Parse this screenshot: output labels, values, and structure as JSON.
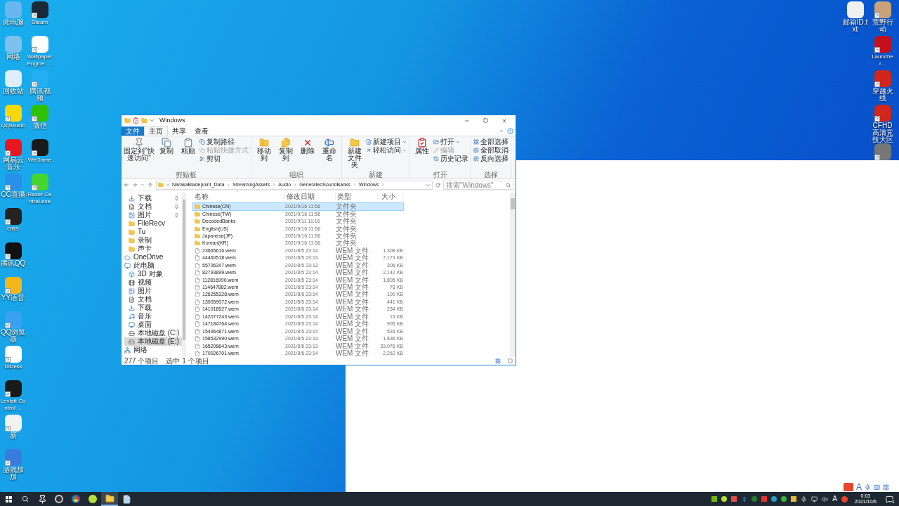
{
  "desktop": {
    "left_column_1": [
      {
        "label": "此电脑",
        "color": "#6ab7f0",
        "shortcut": false
      },
      {
        "label": "网络",
        "color": "#7cc0ee",
        "shortcut": false
      },
      {
        "label": "回收站",
        "color": "#dfeef8",
        "shortcut": false
      },
      {
        "label": "QQMusic",
        "color": "#f5d90a",
        "shortcut": true
      },
      {
        "label": "网易云音乐",
        "color": "#e8161f",
        "shortcut": true
      },
      {
        "label": "CC直播",
        "color": "#2a8fe8",
        "shortcut": true
      },
      {
        "label": "OBS",
        "color": "#222222",
        "shortcut": true
      },
      {
        "label": "腾讯QQ",
        "color": "#111111",
        "shortcut": true
      },
      {
        "label": "YY语音",
        "color": "#f4b81c",
        "shortcut": true
      },
      {
        "label": "QQ浏览器",
        "color": "#3aa1f2",
        "shortcut": true
      },
      {
        "label": "ToDesk",
        "color": "#ffffff",
        "shortcut": true
      },
      {
        "label": "Leviatt Control ...",
        "color": "#1a1a1a",
        "shortcut": true
      },
      {
        "label": "新",
        "color": "#f2f2f2",
        "shortcut": true
      },
      {
        "label": "游戏加加",
        "color": "#3a7be0",
        "shortcut": true
      }
    ],
    "left_column_2": [
      {
        "label": "Steam",
        "color": "#1b2838",
        "shortcut": true
      },
      {
        "label": "Wallpaper Engine: ...",
        "color": "#ffffff",
        "shortcut": true
      },
      {
        "label": "腾讯视频",
        "color": "#22b0f2",
        "shortcut": true
      },
      {
        "label": "微信",
        "color": "#2dc100",
        "shortcut": true
      },
      {
        "label": "WeGame",
        "color": "#1a1a1a",
        "shortcut": true
      },
      {
        "label": "Razer Central.exe",
        "color": "#44d62c",
        "shortcut": true
      }
    ],
    "right_column_1": [
      {
        "label": "邮箱ID.txt",
        "color": "#f0f0f0",
        "shortcut": false
      }
    ],
    "right_column_2": [
      {
        "label": "荒野行动",
        "color": "#c9a27a",
        "shortcut": true
      },
      {
        "label": "Launcher...",
        "color": "#c4101a",
        "shortcut": true
      },
      {
        "label": "穿越火线",
        "color": "#d0261c",
        "shortcut": true
      },
      {
        "label": "CFHD高清竞技大区",
        "color": "#d0261c",
        "shortcut": true
      },
      {
        "color": "#777777",
        "shortcut": true
      }
    ]
  },
  "explorer": {
    "title": "Windows",
    "tabs": [
      {
        "label": "文件",
        "kind": "file",
        "selected": false
      },
      {
        "label": "主页",
        "kind": "tab",
        "selected": true
      },
      {
        "label": "共享",
        "kind": "tab",
        "selected": false
      },
      {
        "label": "查看",
        "kind": "tab",
        "selected": false
      }
    ],
    "ribbon": [
      {
        "label": "剪贴板",
        "large": [
          "固定到\"快速访问\"",
          "复制",
          "粘贴"
        ],
        "small": [
          {
            "label": "复制路径",
            "disabled": false,
            "dropdown": false
          },
          {
            "label": "粘贴快捷方式",
            "disabled": true,
            "dropdown": false
          },
          {
            "label": "剪切",
            "disabled": false,
            "dropdown": false
          }
        ]
      },
      {
        "label": "组织",
        "large": [
          "移动到",
          "复制到",
          "删除",
          "重命名"
        ]
      },
      {
        "label": "新建",
        "large": [
          "新建文件夹"
        ],
        "small": [
          {
            "label": "新建项目",
            "disabled": false,
            "dropdown": true
          },
          {
            "label": "轻松访问",
            "disabled": false,
            "dropdown": true
          }
        ]
      },
      {
        "label": "打开",
        "large": [
          "属性"
        ],
        "small": [
          {
            "label": "打开",
            "disabled": false,
            "dropdown": true
          },
          {
            "label": "编辑",
            "disabled": true,
            "dropdown": false
          },
          {
            "label": "历史记录",
            "disabled": false,
            "dropdown": false
          }
        ]
      },
      {
        "label": "选择",
        "small": [
          {
            "label": "全部选择",
            "disabled": false,
            "dropdown": false
          },
          {
            "label": "全部取消",
            "disabled": false,
            "dropdown": false
          },
          {
            "label": "反向选择",
            "disabled": false,
            "dropdown": false
          }
        ]
      }
    ],
    "path": [
      "NarakaBladepoint_Data",
      "StreamingAssets",
      "Audio",
      "GeneratedSoundBanks",
      "Windows"
    ],
    "search": {
      "placeholder": "搜索\"Windows\""
    },
    "nav": [
      {
        "label": "下载",
        "kind": "download",
        "pinned": true,
        "selected": false
      },
      {
        "label": "文档",
        "kind": "document",
        "pinned": true,
        "selected": false
      },
      {
        "label": "图片",
        "kind": "picture",
        "pinned": true,
        "selected": false
      },
      {
        "label": "FileRecv",
        "kind": "folder",
        "pinned": false,
        "selected": false
      },
      {
        "label": "Tu",
        "kind": "folder",
        "pinned": false,
        "selected": false
      },
      {
        "label": "录制",
        "kind": "folder",
        "pinned": false,
        "selected": false
      },
      {
        "label": "声卡",
        "kind": "folder",
        "pinned": false,
        "selected": false
      },
      {
        "label": "OneDrive",
        "kind": "cloud",
        "pinned": false,
        "selected": false
      },
      {
        "label": "此电脑",
        "kind": "pc",
        "pinned": false,
        "selected": false,
        "children": [
          {
            "label": "3D 对象",
            "kind": "cube",
            "pinned": false,
            "selected": false
          },
          {
            "label": "视频",
            "kind": "video",
            "pinned": false,
            "selected": false
          },
          {
            "label": "图片",
            "kind": "picture",
            "pinned": false,
            "selected": false
          },
          {
            "label": "文档",
            "kind": "document",
            "pinned": false,
            "selected": false
          },
          {
            "label": "下载",
            "kind": "download",
            "pinned": false,
            "selected": false
          },
          {
            "label": "音乐",
            "kind": "music",
            "pinned": false,
            "selected": false
          },
          {
            "label": "桌面",
            "kind": "desktop",
            "pinned": false,
            "selected": false
          },
          {
            "label": "本地磁盘 (C:)",
            "kind": "drive",
            "pinned": false,
            "selected": false
          },
          {
            "label": "本地磁盘 (E:)",
            "kind": "drive",
            "pinned": false,
            "selected": true
          }
        ]
      },
      {
        "label": "网络",
        "kind": "network",
        "pinned": false,
        "selected": false
      }
    ],
    "columns": [
      "名称",
      "修改日期",
      "类型",
      "大小"
    ],
    "rows": [
      {
        "kind": "folder",
        "selected": true,
        "name": "Chinese(CN)",
        "date": "2021/9/16 11:56",
        "type": "文件夹"
      },
      {
        "kind": "folder",
        "selected": false,
        "name": "Chinese(TW)",
        "date": "2021/9/16 11:56",
        "type": "文件夹"
      },
      {
        "kind": "folder",
        "selected": false,
        "name": "DecodedBanks",
        "date": "2021/9/11 11:16",
        "type": "文件夹"
      },
      {
        "kind": "folder",
        "selected": false,
        "name": "English(US)",
        "date": "2021/9/16 11:56",
        "type": "文件夹"
      },
      {
        "kind": "folder",
        "selected": false,
        "name": "Japanese(JP)",
        "date": "2021/9/16 11:56",
        "type": "文件夹"
      },
      {
        "kind": "folder",
        "selected": false,
        "name": "Korean(KR)",
        "date": "2021/9/16 11:56",
        "type": "文件夹"
      },
      {
        "kind": "file",
        "selected": false,
        "name": "23665616.wem",
        "date": "2021/8/5 23:14",
        "type": "WEM 文件",
        "size": "1,308 KB"
      },
      {
        "kind": "file",
        "selected": false,
        "name": "44460518.wem",
        "date": "2021/8/5 23:13",
        "type": "WEM 文件",
        "size": "7,173 KB"
      },
      {
        "kind": "file",
        "selected": false,
        "name": "55706347.wem",
        "date": "2021/8/5 23:13",
        "type": "WEM 文件",
        "size": "306 KB"
      },
      {
        "kind": "file",
        "selected": false,
        "name": "82793899.wem",
        "date": "2021/8/5 23:14",
        "type": "WEM 文件",
        "size": "2,142 KB"
      },
      {
        "kind": "file",
        "selected": false,
        "name": "112816990.wem",
        "date": "2021/8/5 23:14",
        "type": "WEM 文件",
        "size": "1,805 KB"
      },
      {
        "kind": "file",
        "selected": false,
        "name": "114647882.wem",
        "date": "2021/8/5 23:14",
        "type": "WEM 文件",
        "size": "78 KB"
      },
      {
        "kind": "file",
        "selected": false,
        "name": "126255328.wem",
        "date": "2021/8/5 23:14",
        "type": "WEM 文件",
        "size": "100 KB"
      },
      {
        "kind": "file",
        "selected": false,
        "name": "130059072.wem",
        "date": "2021/8/5 23:14",
        "type": "WEM 文件",
        "size": "441 KB"
      },
      {
        "kind": "file",
        "selected": false,
        "name": "141018527.wem",
        "date": "2021/8/5 23:14",
        "type": "WEM 文件",
        "size": "234 KB"
      },
      {
        "kind": "file",
        "selected": false,
        "name": "142077243.wem",
        "date": "2021/8/5 23:14",
        "type": "WEM 文件",
        "size": "15 KB"
      },
      {
        "kind": "file",
        "selected": false,
        "name": "147184764.wem",
        "date": "2021/8/5 23:14",
        "type": "WEM 文件",
        "size": "905 KB"
      },
      {
        "kind": "file",
        "selected": false,
        "name": "154964871.wem",
        "date": "2021/8/5 23:14",
        "type": "WEM 文件",
        "size": "533 KB"
      },
      {
        "kind": "file",
        "selected": false,
        "name": "158532990.wem",
        "date": "2021/8/5 23:13",
        "type": "WEM 文件",
        "size": "1,836 KB"
      },
      {
        "kind": "file",
        "selected": false,
        "name": "165208643.wem",
        "date": "2021/8/5 23:13",
        "type": "WEM 文件",
        "size": "33,076 KB"
      },
      {
        "kind": "file",
        "selected": false,
        "name": "170026701.wem",
        "date": "2021/8/5 23:14",
        "type": "WEM 文件",
        "size": "2,262 KB"
      }
    ],
    "status": [
      "277 个项目",
      "选中 1 个项目"
    ]
  },
  "ime_bar": {
    "mode": "A"
  },
  "taskbar": {
    "apps": [
      {
        "kind": "pin",
        "selected": false
      },
      {
        "kind": "circle",
        "selected": false
      },
      {
        "kind": "browser",
        "selected": false
      },
      {
        "kind": "ball",
        "selected": false
      },
      {
        "kind": "explorer",
        "selected": true
      },
      {
        "kind": "notepad",
        "selected": false
      }
    ],
    "input_mode": "A",
    "time": "0:03",
    "date": "2021/10/6",
    "notifications": "1"
  }
}
